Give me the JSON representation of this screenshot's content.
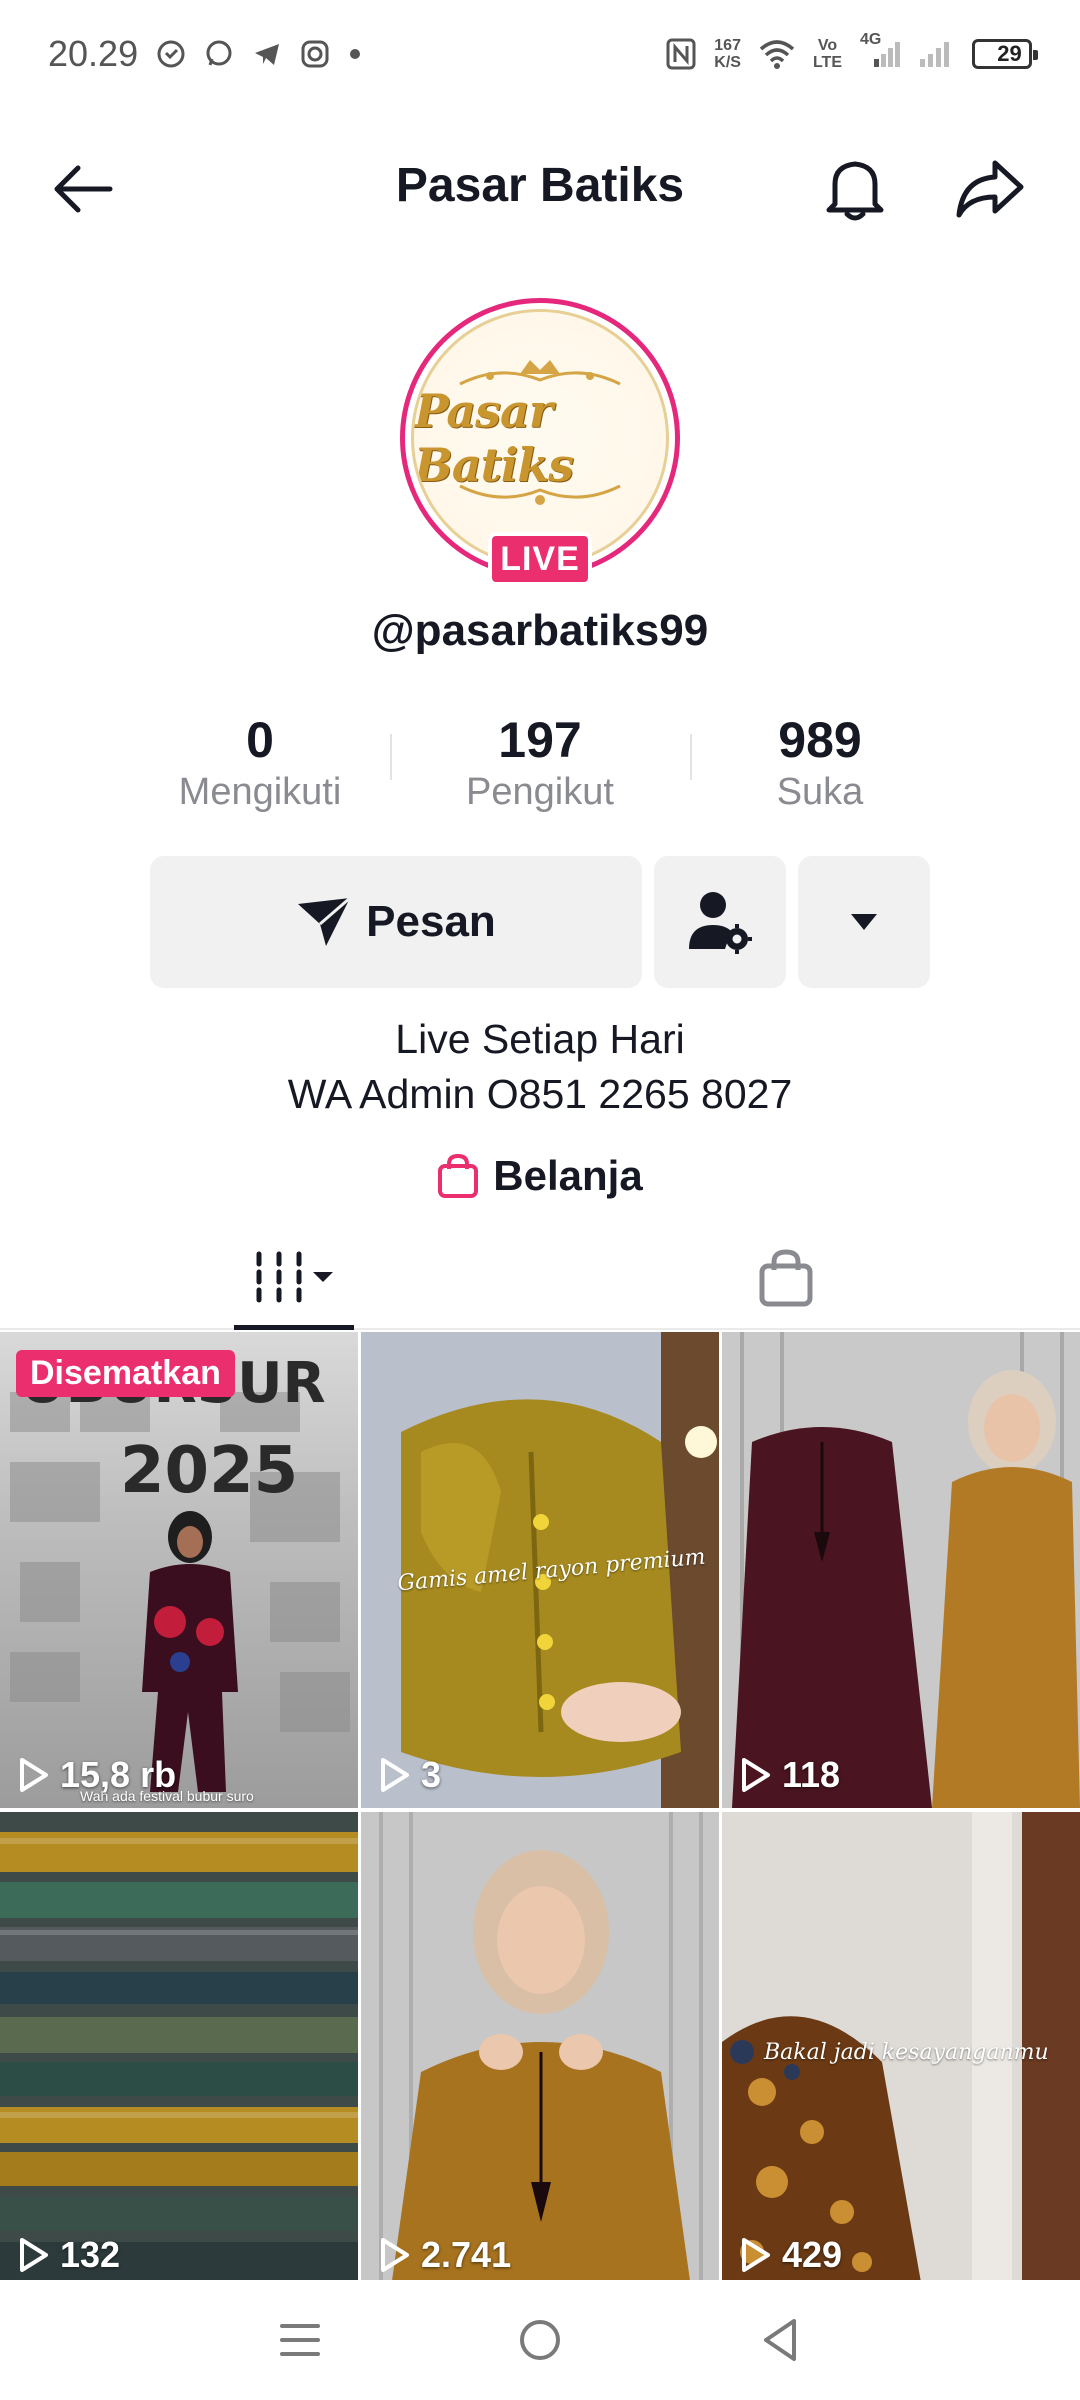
{
  "status_bar": {
    "time": "20.29",
    "net_speed_top": "167",
    "net_speed_bottom": "K/S",
    "volte_top": "Vo",
    "volte_bottom": "LTE",
    "network": "4G",
    "battery": "29",
    "battery_level": 0.29
  },
  "header": {
    "title": "Pasar Batiks"
  },
  "profile": {
    "avatar_logo_text": "Pasar Batiks",
    "live_badge": "LIVE",
    "username": "@pasarbatiks99"
  },
  "stats": [
    {
      "value": "0",
      "label": "Mengikuti"
    },
    {
      "value": "197",
      "label": "Pengikut"
    },
    {
      "value": "989",
      "label": "Suka"
    }
  ],
  "actions": {
    "message_label": "Pesan"
  },
  "bio": {
    "line1": "Live Setiap Hari",
    "line2": "WA Admin O851 2265 8027"
  },
  "shop_link": {
    "label": "Belanja"
  },
  "videos": [
    {
      "views": "15,8 rb",
      "pinned_label": "Disematkan",
      "caption": "Wah ada festival bubur suro"
    },
    {
      "views": "3",
      "caption": "Gamis amel rayon premium"
    },
    {
      "views": "118"
    },
    {
      "views": "132"
    },
    {
      "views": "2.741"
    },
    {
      "views": "429",
      "caption": "Bakal jadi kesayanganmu"
    }
  ],
  "colors": {
    "accent": "#ea2e6e",
    "text": "#161823",
    "muted": "#8a8b91",
    "button_bg": "#f1f1f2"
  }
}
